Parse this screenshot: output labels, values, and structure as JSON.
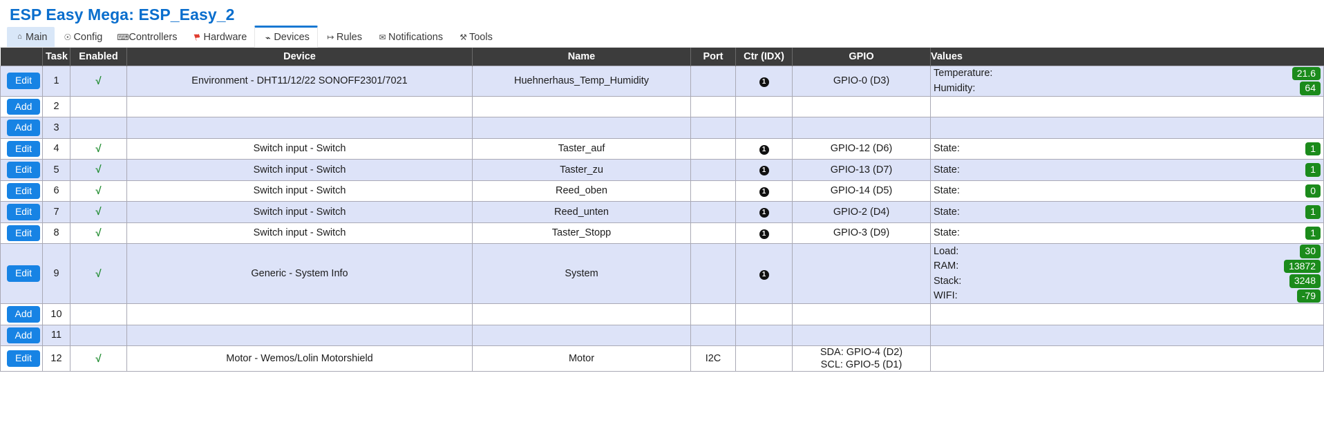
{
  "header": {
    "title": "ESP Easy Mega: ESP_Easy_2",
    "title_color": "#0a6ecd"
  },
  "tabs": [
    {
      "label": "Main",
      "icon": "home-icon",
      "glyph": "⌂",
      "state": "home"
    },
    {
      "label": "Config",
      "icon": "gear-icon",
      "glyph": "☉",
      "state": "normal"
    },
    {
      "label": "Controllers",
      "icon": "chat-icon",
      "glyph": "ὊC",
      "state": "normal"
    },
    {
      "label": "Hardware",
      "icon": "pin-icon",
      "glyph": "ὌC",
      "state": "normal"
    },
    {
      "label": "Devices",
      "icon": "plug-icon",
      "glyph": "ὐC",
      "state": "active"
    },
    {
      "label": "Rules",
      "icon": "rules-icon",
      "glyph": "↦",
      "state": "normal"
    },
    {
      "label": "Notifications",
      "icon": "mail-icon",
      "glyph": "✉",
      "state": "normal"
    },
    {
      "label": "Tools",
      "icon": "tools-icon",
      "glyph": "✐",
      "state": "normal"
    }
  ],
  "table": {
    "columns": [
      "",
      "Task",
      "Enabled",
      "Device",
      "Name",
      "Port",
      "Ctr (IDX)",
      "GPIO",
      "Values"
    ],
    "edit_label": "Edit",
    "add_label": "Add",
    "enabled_mark": "√",
    "idx_mark": "1",
    "rows": [
      {
        "action": "Edit",
        "task": "1",
        "enabled": true,
        "device": "Environment - DHT11/12/22 SONOFF2301/7021",
        "name": "Huehnerhaus_Temp_Humidity",
        "port": "",
        "ctr": true,
        "gpio": [
          "GPIO-0 (D3)"
        ],
        "values": [
          {
            "label": "Temperature:",
            "value": "21.6"
          },
          {
            "label": "Humidity:",
            "value": "64"
          }
        ]
      },
      {
        "action": "Add",
        "task": "2",
        "enabled": false,
        "device": "",
        "name": "",
        "port": "",
        "ctr": false,
        "gpio": [],
        "values": []
      },
      {
        "action": "Add",
        "task": "3",
        "enabled": false,
        "device": "",
        "name": "",
        "port": "",
        "ctr": false,
        "gpio": [],
        "values": []
      },
      {
        "action": "Edit",
        "task": "4",
        "enabled": true,
        "device": "Switch input - Switch",
        "name": "Taster_auf",
        "port": "",
        "ctr": true,
        "gpio": [
          "GPIO-12 (D6)"
        ],
        "values": [
          {
            "label": "State:",
            "value": "1"
          }
        ]
      },
      {
        "action": "Edit",
        "task": "5",
        "enabled": true,
        "device": "Switch input - Switch",
        "name": "Taster_zu",
        "port": "",
        "ctr": true,
        "gpio": [
          "GPIO-13 (D7)"
        ],
        "values": [
          {
            "label": "State:",
            "value": "1"
          }
        ]
      },
      {
        "action": "Edit",
        "task": "6",
        "enabled": true,
        "device": "Switch input - Switch",
        "name": "Reed_oben",
        "port": "",
        "ctr": true,
        "gpio": [
          "GPIO-14 (D5)"
        ],
        "values": [
          {
            "label": "State:",
            "value": "0"
          }
        ]
      },
      {
        "action": "Edit",
        "task": "7",
        "enabled": true,
        "device": "Switch input - Switch",
        "name": "Reed_unten",
        "port": "",
        "ctr": true,
        "gpio": [
          "GPIO-2 (D4)"
        ],
        "values": [
          {
            "label": "State:",
            "value": "1"
          }
        ]
      },
      {
        "action": "Edit",
        "task": "8",
        "enabled": true,
        "device": "Switch input - Switch",
        "name": "Taster_Stopp",
        "port": "",
        "ctr": true,
        "gpio": [
          "GPIO-3 (D9)"
        ],
        "values": [
          {
            "label": "State:",
            "value": "1"
          }
        ]
      },
      {
        "action": "Edit",
        "task": "9",
        "enabled": true,
        "device": "Generic - System Info",
        "name": "System",
        "port": "",
        "ctr": true,
        "gpio": [],
        "values": [
          {
            "label": "Load:",
            "value": "30"
          },
          {
            "label": "RAM:",
            "value": "13872"
          },
          {
            "label": "Stack:",
            "value": "3248"
          },
          {
            "label": "WIFI:",
            "value": "-79"
          }
        ]
      },
      {
        "action": "Add",
        "task": "10",
        "enabled": false,
        "device": "",
        "name": "",
        "port": "",
        "ctr": false,
        "gpio": [],
        "values": []
      },
      {
        "action": "Add",
        "task": "11",
        "enabled": false,
        "device": "",
        "name": "",
        "port": "",
        "ctr": false,
        "gpio": [],
        "values": []
      },
      {
        "action": "Edit",
        "task": "12",
        "enabled": true,
        "device": "Motor - Wemos/Lolin Motorshield",
        "name": "Motor",
        "port": "I2C",
        "ctr": false,
        "gpio": [
          "SDA: GPIO-4 (D2)",
          "SCL: GPIO-5 (D1)"
        ],
        "values": []
      }
    ]
  },
  "colors": {
    "accent": "#1783e4",
    "header_bg": "#3c3c3c",
    "row_odd": "#dde3f8",
    "pill_green": "#1b8b1b",
    "check_green": "#1f8b2f"
  }
}
